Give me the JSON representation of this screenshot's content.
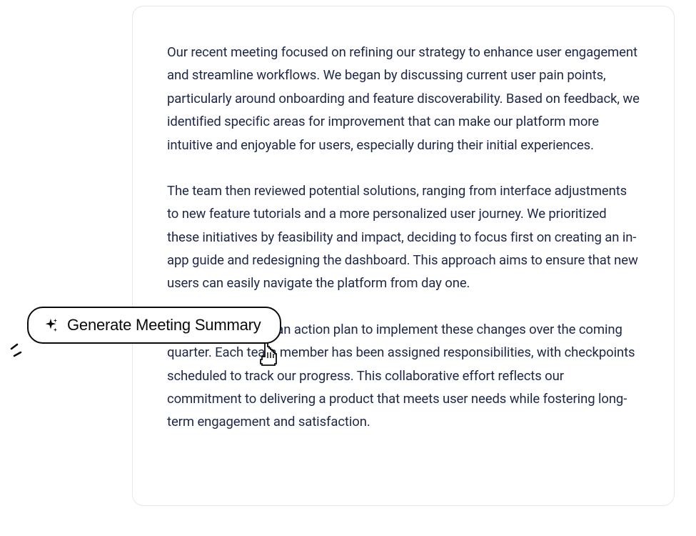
{
  "document": {
    "paragraphs": [
      "Our recent meeting focused on refining our strategy to enhance user engagement and streamline workflows. We began by discussing current user pain points, particularly around onboarding and feature discoverability. Based on feedback, we identified specific areas for improvement that can make our platform more intuitive and enjoyable for users, especially during their initial experiences.",
      "The team then reviewed potential solutions, ranging from interface adjustments to new feature tutorials and a more personalized user journey. We prioritized these initiatives by feasibility and impact, deciding to focus first on creating an in-app guide and redesigning the dashboard. This approach aims to ensure that new users can easily navigate the platform from day one.",
      "Lastly, we outlined an action plan to implement these changes over the coming quarter. Each team member has been assigned responsibilities, with checkpoints scheduled to track our progress. This collaborative effort reflects our commitment to delivering a product that meets user needs while fostering long-term engagement and satisfaction."
    ]
  },
  "action_button": {
    "label": "Generate Meeting Summary"
  }
}
